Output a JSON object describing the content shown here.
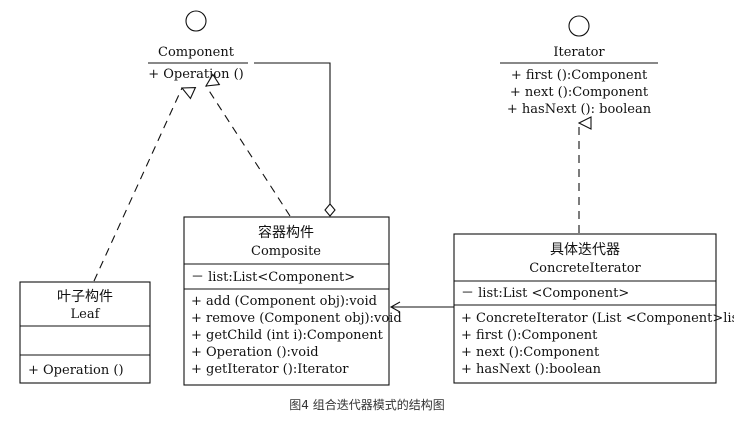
{
  "component": {
    "name": "Component",
    "method": "+ Operation ()"
  },
  "iterator": {
    "name": "Iterator",
    "methods": [
      "+ first ():Component",
      "+ next ():Component",
      "+ hasNext (): boolean"
    ]
  },
  "composite": {
    "chinese": "容器构件",
    "name": "Composite",
    "attribute": "－ list:List<Component>",
    "methods": [
      "+ add (Component obj):void",
      "+ remove (Component obj):void",
      "+ getChild (int i):Component",
      "+ Operation ():void",
      "+ getIterator ():Iterator"
    ]
  },
  "leaf": {
    "chinese": "叶子构件",
    "name": "Leaf",
    "method": "+ Operation ()"
  },
  "concrete_iterator": {
    "chinese": "具体迭代器",
    "name": "ConcreteIterator",
    "attribute": "－ list:List <Component>",
    "methods": [
      "+ ConcreteIterator (List <Component>list)",
      "+ first ():Component",
      "+ next ():Component",
      "+ hasNext ():boolean"
    ]
  },
  "caption": "图4 组合迭代器模式的结构图"
}
